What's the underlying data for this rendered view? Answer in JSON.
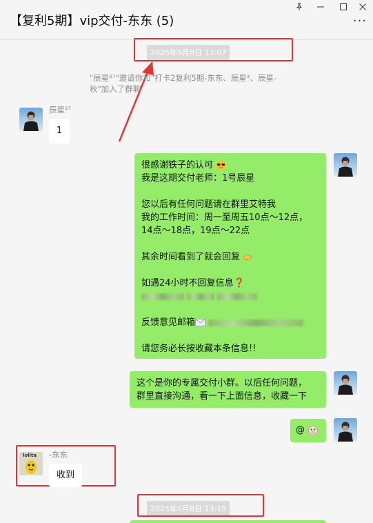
{
  "window": {
    "title": "【复利5期】vip交付-东东 (5)",
    "pin_icon": "pin-icon",
    "minimize_icon": "minimize-icon",
    "maximize_icon": "maximize-icon",
    "close_icon": "close-icon",
    "more_icon": "more-icon"
  },
  "colors": {
    "highlight": "#e53333",
    "green_bubble": "#95ec69",
    "white_bubble": "#ffffff",
    "background": "#f5f5f5"
  },
  "chat": {
    "timestamp_1": "2025年5月8日 13:07",
    "system_message": "\"辰星²⁷\"邀请你和\"打卡2复利5期-东东、辰星²、辰星-秋\"加入了群聊",
    "msg1": {
      "sender": "辰星²⁷",
      "text": "1"
    },
    "msg2": {
      "lines": [
        "很感谢铁子的认可",
        "我是这期交付老师：1号辰星",
        "",
        "您以后有任何问题请在群里艾特我",
        "我的工作时间：周一至周五10点～12点，",
        "14点～18点，19点～22点",
        "",
        "其余时间看到了就会回复",
        "",
        "如遇24小时不回复信息",
        "",
        "",
        "反馈意见邮箱",
        "",
        "请您务必长按收藏本条信息!!"
      ]
    },
    "msg3": {
      "lines": [
        "这个是你的专属交付小群。以后任何问题，",
        "群里直接沟通，看一下上面信息，收藏一下"
      ]
    },
    "msg4": {
      "text": "@"
    },
    "msg5": {
      "sender": "-东东",
      "text": "收到",
      "avatar_caption": "lolita"
    },
    "timestamp_2": "2025年5月8日 13:19"
  }
}
